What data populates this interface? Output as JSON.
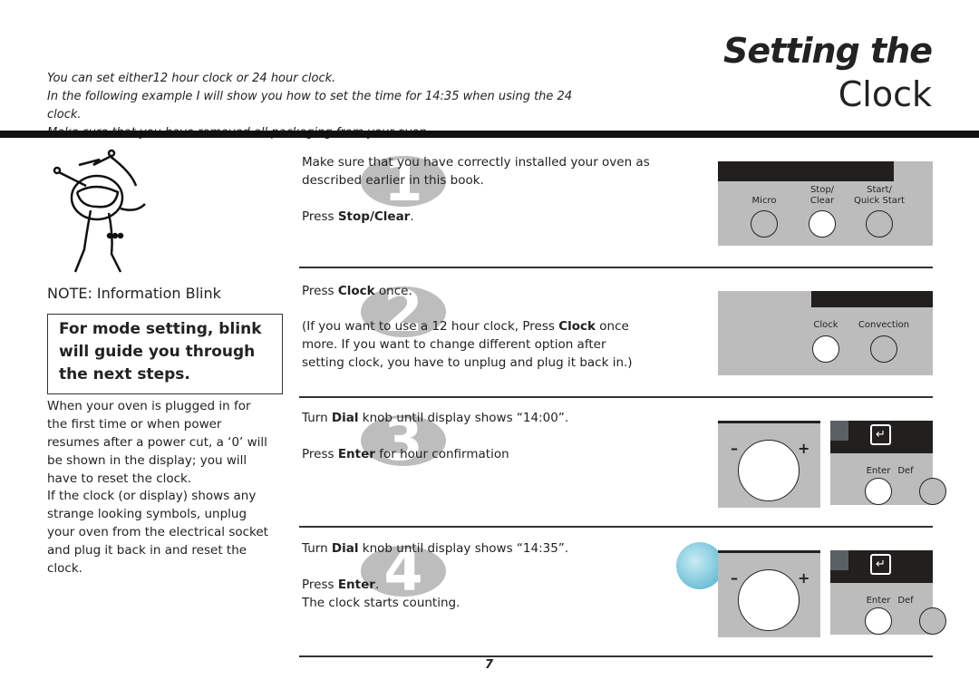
{
  "header": {
    "title_line1": "Setting the",
    "title_line2": "Clock",
    "intro": [
      "You can set either12 hour clock or 24 hour clock.",
      "In the following example I will show you how to set the time for 14:35 when using the 24 clock.",
      "Make sure that you have removed all packaging from your oven."
    ]
  },
  "sidebar": {
    "note_title": "NOTE: Information Blink",
    "note_box": "For mode setting, blink will guide you through the next steps.",
    "para1": "When your oven is plugged in for the first time or when power resumes after a power cut, a ‘0’ will be shown in the display; you will have to reset the clock.",
    "para2": "If the clock (or display) shows any strange looking symbols, unplug your oven from the electrical socket and plug it back in and reset the clock."
  },
  "steps": [
    {
      "number": "1",
      "lines": [
        "Make sure that you have correctly installed your oven as described earlier in this book."
      ],
      "press": "Press ",
      "key": "Stop/Clear",
      "after": "."
    },
    {
      "number": "2",
      "press": "Press ",
      "key": "Clock",
      "after": " once.",
      "note_pre": "(If you want to use a 12 hour clock, Press ",
      "note_key": "Clock",
      "note_post": " once more. If you want to change different option after setting clock, you have to unplug and plug it back in.)"
    },
    {
      "number": "3",
      "turn_pre": "Turn ",
      "turn_key": "Dial",
      "turn_post": " knob until display shows “14:00”.",
      "press": "Press ",
      "key": "Enter",
      "after": " for hour confirmation"
    },
    {
      "number": "4",
      "turn_pre": "Turn ",
      "turn_key": "Dial",
      "turn_post": " knob until display shows “14:35”.",
      "press": "Press ",
      "key": "Enter",
      "after": ".",
      "extra": "The clock starts counting."
    }
  ],
  "panels": {
    "micro": "Micro",
    "stop_clear": "Stop/\nClear",
    "start": "Start/\nQuick Start",
    "clock": "Clock",
    "convection": "Convection",
    "enter": "Enter",
    "defrost_partial": "Def",
    "plus": "+",
    "minus": "–"
  },
  "footer": {
    "page_number": "7"
  },
  "colors": {
    "panel": "#bcbcbd",
    "badge": "#bdbdbd",
    "bar": "#111111"
  }
}
